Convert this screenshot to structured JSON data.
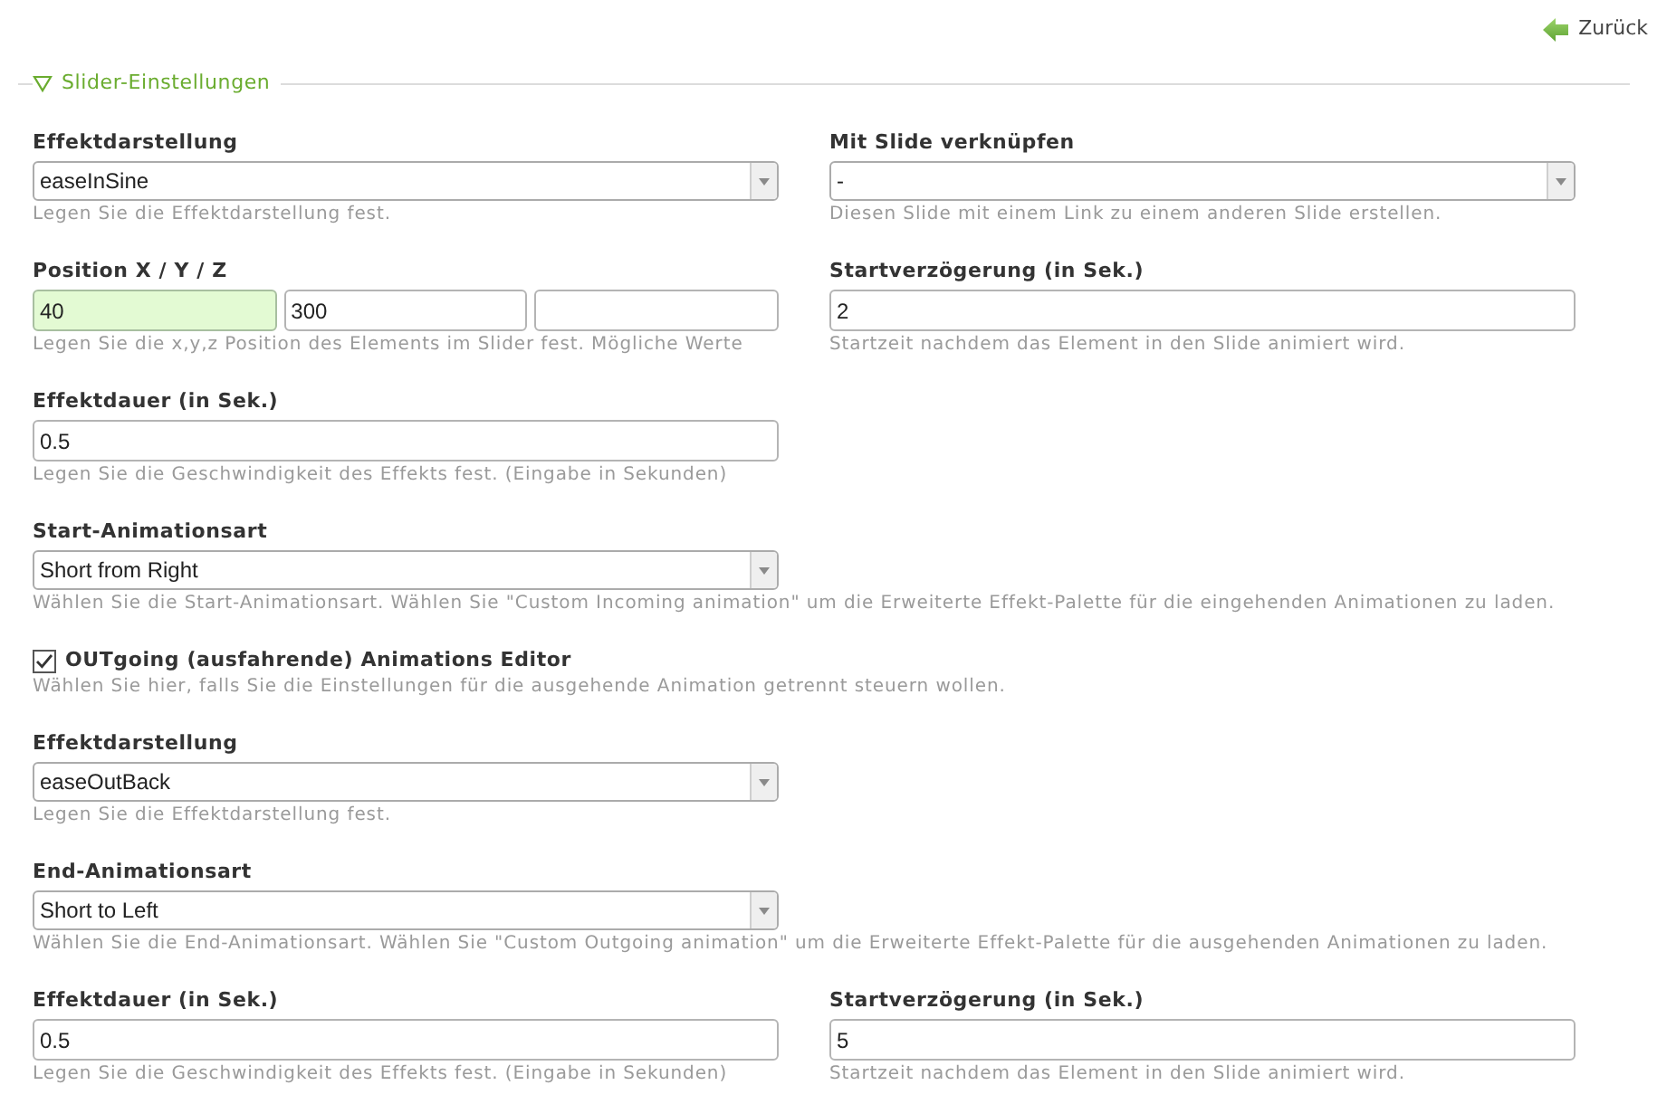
{
  "back_link": {
    "label": "Zurück"
  },
  "fieldset": {
    "legend": "Slider-Einstellungen",
    "expanded": true
  },
  "rows": [
    {
      "fields": [
        {
          "kind": "select",
          "label": "Effektdarstellung",
          "value": "easeInSine",
          "help": "Legen Sie die Effektdarstellung fest."
        },
        {
          "kind": "select",
          "label": "Mit Slide verknüpfen",
          "value": "-",
          "help": "Diesen Slide mit einem Link zu einem anderen Slide erstellen."
        }
      ]
    },
    {
      "fields": [
        {
          "kind": "multi",
          "label": "Position X / Y / Z",
          "inputs": [
            {
              "value": "40",
              "focused": true
            },
            {
              "value": "300",
              "focused": false
            },
            {
              "focused": false
            }
          ],
          "help": "Legen Sie die x,y,z Position des Elements im Slider fest. Mögliche Werte"
        },
        {
          "kind": "text",
          "label": "Startverzögerung (in Sek.)",
          "value": "2",
          "help": "Startzeit nachdem das Element in den Slide animiert wird."
        }
      ]
    },
    {
      "fields": [
        {
          "kind": "text",
          "label": "Effektdauer (in Sek.)",
          "value": "0.5",
          "help": "Legen Sie die Geschwindigkeit des Effekts fest. (Eingabe in Sekunden)"
        }
      ]
    },
    {
      "fields": [
        {
          "kind": "select",
          "label": "Start-Animationsart",
          "value": "Short from Right",
          "help": "Wählen Sie die Start-Animationsart. Wählen Sie \"Custom Incoming animation\" um die Erweiterte Effekt-Palette für die eingehenden Animationen zu laden."
        }
      ]
    },
    {
      "fields": [
        {
          "kind": "checkbox",
          "label": "OUTgoing (ausfahrende) Animations Editor",
          "checked": true,
          "help": "Wählen Sie hier, falls Sie die Einstellungen für die ausgehende Animation getrennt steuern wollen."
        }
      ]
    },
    {
      "fields": [
        {
          "kind": "select",
          "label": "Effektdarstellung",
          "value": "easeOutBack",
          "help": "Legen Sie die Effektdarstellung fest."
        }
      ]
    },
    {
      "fields": [
        {
          "kind": "select",
          "label": "End-Animationsart",
          "value": "Short to Left",
          "help": "Wählen Sie die End-Animationsart. Wählen Sie \"Custom Outgoing animation\" um die Erweiterte Effekt-Palette für die ausgehenden Animationen zu laden."
        }
      ]
    },
    {
      "fields": [
        {
          "kind": "text",
          "label": "Effektdauer (in Sek.)",
          "value": "0.5",
          "help": "Legen Sie die Geschwindigkeit des Effekts fest. (Eingabe in Sekunden)"
        },
        {
          "kind": "text",
          "label": "Startverzögerung (in Sek.)",
          "value": "5",
          "help": "Startzeit nachdem das Element in den Slide animiert wird."
        }
      ]
    }
  ]
}
